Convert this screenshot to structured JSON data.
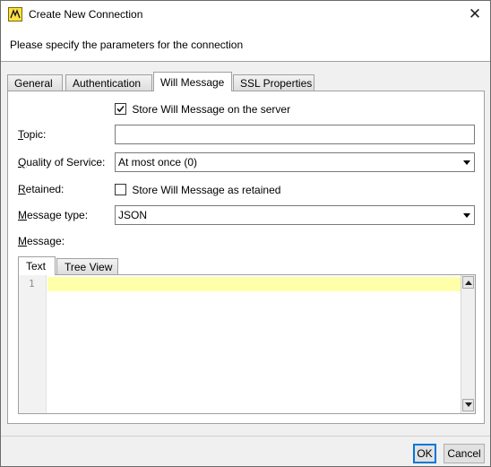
{
  "window": {
    "title": "Create New Connection",
    "close_symbol": "✕",
    "icon": "mqtt-app-icon"
  },
  "header": {
    "text": "Please specify the parameters for the connection"
  },
  "tabs": [
    {
      "label": "General"
    },
    {
      "label": "Authentication"
    },
    {
      "label": "Will Message",
      "active": true
    },
    {
      "label": "SSL Properties"
    }
  ],
  "will": {
    "store_on_server": {
      "label": "Store Will Message on the server",
      "checked": true
    },
    "topic": {
      "label": "Topic:",
      "value": ""
    },
    "qos": {
      "label": "Quality of Service:",
      "value": "At most once (0)"
    },
    "retained": {
      "label": "Retained:",
      "checkbox_label": "Store Will Message as retained",
      "checked": false
    },
    "message_type": {
      "label": "Message type:",
      "value": "JSON"
    },
    "message": {
      "label": "Message:"
    }
  },
  "editor": {
    "tabs": [
      {
        "label": "Text",
        "active": true
      },
      {
        "label": "Tree View"
      }
    ],
    "line_number": "1",
    "highlight_color": "#ffffaa"
  },
  "buttons": {
    "ok": "OK",
    "cancel": "Cancel"
  },
  "colors": {
    "accent": "#0078d7",
    "window_bg": "#f0f0f0"
  }
}
